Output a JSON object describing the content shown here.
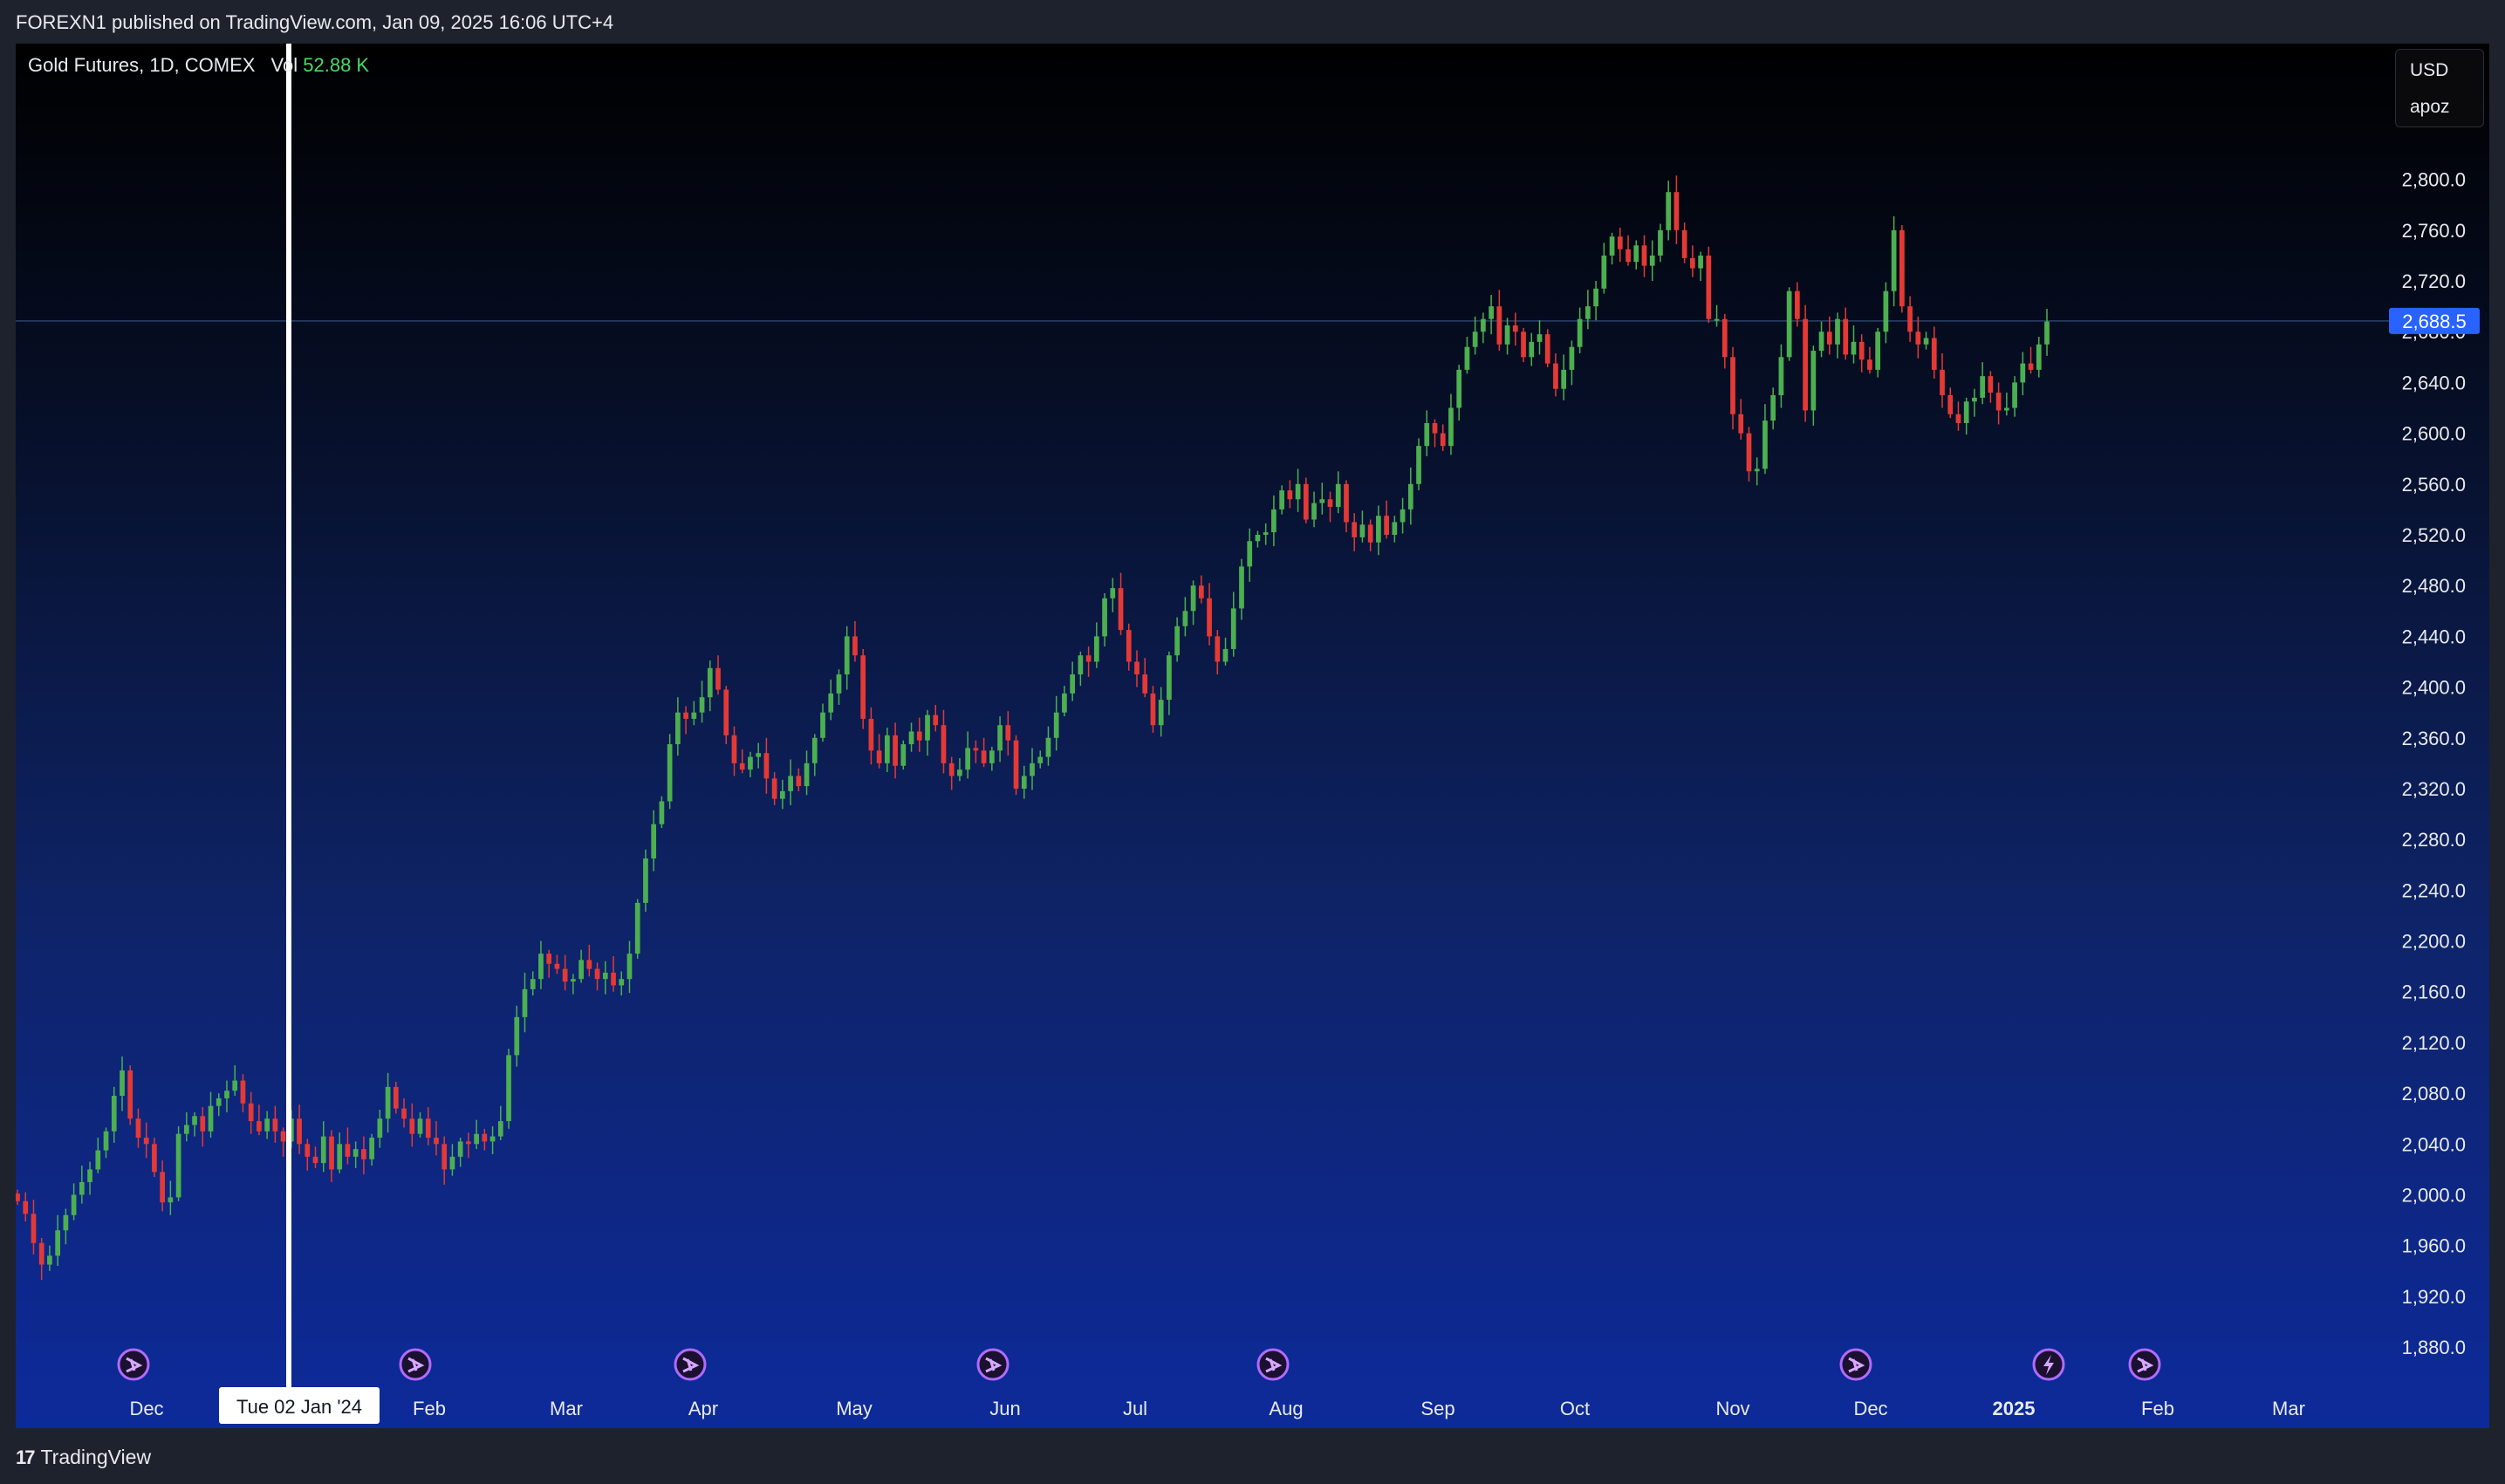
{
  "header": {
    "published_text": "FOREXN1 published on TradingView.com, Jan 09, 2025 16:06 UTC+4"
  },
  "legend": {
    "symbol": "Gold Futures, 1D, COMEX",
    "vol_label": "Vol",
    "vol_value": "52.88 K"
  },
  "currency_box": {
    "currency": "USD",
    "unit": "apoz"
  },
  "crosshair": {
    "date_label": "Tue 02 Jan '24"
  },
  "price_label": {
    "value": "2,688.5",
    "price": 2688.5
  },
  "footer": {
    "brand": "TradingView",
    "logo_mark": "17"
  },
  "colors": {
    "up": "#4caf50",
    "down": "#e53935",
    "price_tag": "#2962ff",
    "event_icon": "#9c27b0",
    "crosshair": "#ffffff"
  },
  "event_icons": [
    "dividend-arrow-icon",
    "dividend-arrow-icon",
    "dividend-arrow-icon",
    "dividend-arrow-icon",
    "dividend-arrow-icon",
    "dividend-arrow-icon",
    "lightning-icon",
    "dividend-arrow-icon"
  ],
  "chart_data": {
    "type": "candlestick",
    "ylim": [
      1845,
      2852
    ],
    "y_ticks": [
      "1,880.0",
      "1,920.0",
      "1,960.0",
      "2,000.0",
      "2,040.0",
      "2,080.0",
      "2,120.0",
      "2,160.0",
      "2,200.0",
      "2,240.0",
      "2,280.0",
      "2,320.0",
      "2,360.0",
      "2,400.0",
      "2,440.0",
      "2,480.0",
      "2,520.0",
      "2,560.0",
      "2,600.0",
      "2,640.0",
      "2,680.0",
      "2,720.0",
      "2,760.0",
      "2,800.0"
    ],
    "x_ticks": [
      "Dec",
      "Feb",
      "Mar",
      "Apr",
      "May",
      "Jun",
      "Jul",
      "Aug",
      "Sep",
      "Oct",
      "Nov",
      "Dec",
      "2025",
      "Feb",
      "Mar"
    ],
    "x_ticks_bold": [
      false,
      false,
      false,
      false,
      false,
      false,
      false,
      false,
      false,
      false,
      false,
      false,
      true,
      false,
      false
    ],
    "closes": [
      1995,
      1985,
      1962,
      1945,
      1952,
      1972,
      1984,
      2000,
      2010,
      2020,
      2035,
      2050,
      2078,
      2098,
      2060,
      2045,
      2040,
      2018,
      1994,
      1998,
      2048,
      2055,
      2062,
      2050,
      2070,
      2076,
      2082,
      2090,
      2072,
      2058,
      2050,
      2060,
      2050,
      2042,
      2060,
      2040,
      2030,
      2025,
      2046,
      2020,
      2040,
      2030,
      2036,
      2028,
      2045,
      2060,
      2085,
      2068,
      2060,
      2048,
      2060,
      2045,
      2040,
      2020,
      2030,
      2042,
      2040,
      2048,
      2042,
      2046,
      2058,
      2110,
      2140,
      2162,
      2170,
      2190,
      2182,
      2178,
      2168,
      2170,
      2185,
      2178,
      2170,
      2175,
      2165,
      2170,
      2190,
      2230,
      2265,
      2292,
      2310,
      2355,
      2380,
      2375,
      2380,
      2392,
      2415,
      2398,
      2362,
      2340,
      2335,
      2345,
      2348,
      2328,
      2312,
      2318,
      2330,
      2322,
      2340,
      2360,
      2380,
      2395,
      2410,
      2440,
      2425,
      2375,
      2350,
      2340,
      2362,
      2338,
      2355,
      2365,
      2358,
      2378,
      2370,
      2340,
      2330,
      2335,
      2352,
      2350,
      2340,
      2350,
      2370,
      2358,
      2320,
      2330,
      2340,
      2345,
      2360,
      2380,
      2395,
      2410,
      2425,
      2420,
      2440,
      2470,
      2478,
      2445,
      2420,
      2410,
      2395,
      2370,
      2390,
      2425,
      2448,
      2460,
      2480,
      2470,
      2440,
      2420,
      2430,
      2462,
      2495,
      2515,
      2520,
      2522,
      2540,
      2555,
      2548,
      2560,
      2532,
      2545,
      2548,
      2542,
      2560,
      2530,
      2518,
      2528,
      2514,
      2535,
      2520,
      2530,
      2540,
      2560,
      2590,
      2608,
      2600,
      2590,
      2620,
      2650,
      2668,
      2680,
      2690,
      2700,
      2670,
      2685,
      2680,
      2660,
      2672,
      2678,
      2655,
      2635,
      2650,
      2668,
      2690,
      2700,
      2714,
      2740,
      2755,
      2745,
      2735,
      2748,
      2732,
      2740,
      2760,
      2790,
      2760,
      2738,
      2730,
      2740,
      2690,
      2690,
      2660,
      2615,
      2600,
      2570,
      2572,
      2610,
      2630,
      2660,
      2712,
      2690,
      2618,
      2665,
      2680,
      2670,
      2690,
      2662,
      2672,
      2658,
      2650,
      2680,
      2712,
      2760,
      2700,
      2680,
      2670,
      2675,
      2650,
      2630,
      2615,
      2608,
      2625,
      2628,
      2645,
      2632,
      2618,
      2620,
      2640,
      2655,
      2650,
      2670,
      2688
    ]
  }
}
